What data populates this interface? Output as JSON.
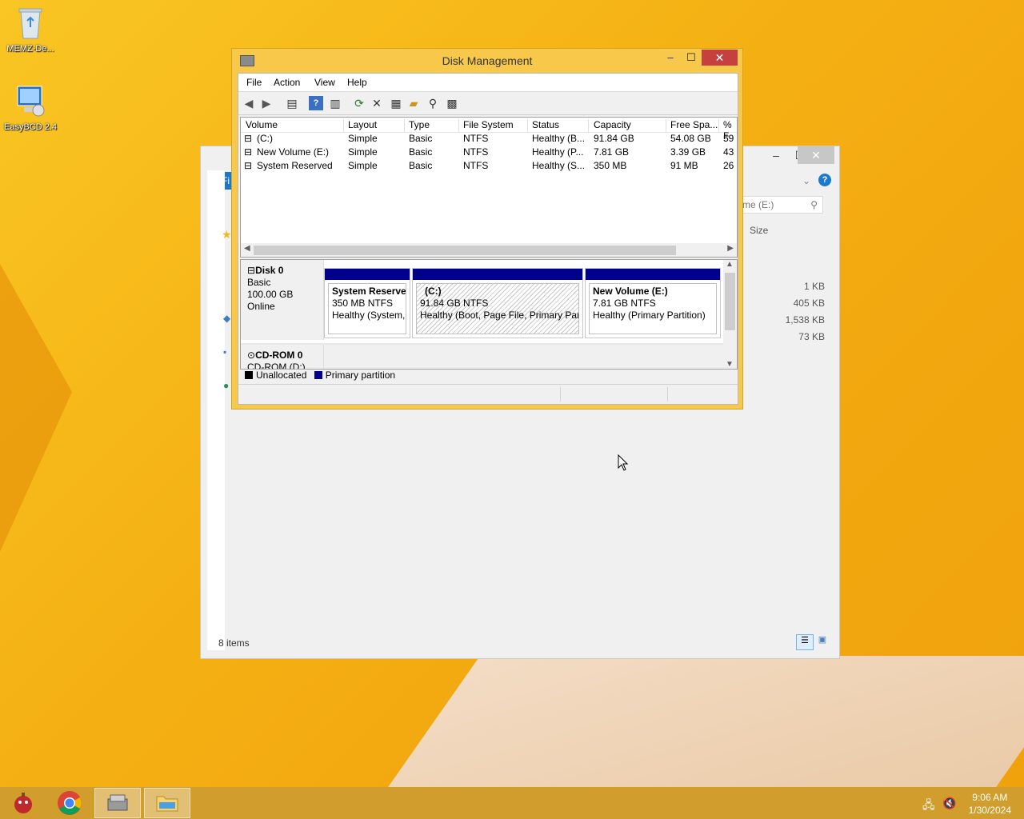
{
  "desktop": {
    "icons": [
      {
        "label": "MEMZ-De..."
      },
      {
        "label": "EasyBCD 2.4"
      }
    ]
  },
  "explorer": {
    "ribbon_tab": "Fi",
    "search_placeholder": "me (E:)",
    "size_header": "Size",
    "sizes": [
      "1 KB",
      "405 KB",
      "1,538 KB",
      "73 KB"
    ],
    "status": "8 items"
  },
  "disk_management": {
    "title": "Disk Management",
    "menu": [
      "File",
      "Action",
      "View",
      "Help"
    ],
    "columns": [
      "Volume",
      "Layout",
      "Type",
      "File System",
      "Status",
      "Capacity",
      "Free Spa...",
      "% F"
    ],
    "volumes": [
      {
        "volume": "(C:)",
        "layout": "Simple",
        "type": "Basic",
        "fs": "NTFS",
        "status": "Healthy (B...",
        "capacity": "91.84 GB",
        "free": "54.08 GB",
        "pct": "59"
      },
      {
        "volume": "New Volume (E:)",
        "layout": "Simple",
        "type": "Basic",
        "fs": "NTFS",
        "status": "Healthy (P...",
        "capacity": "7.81 GB",
        "free": "3.39 GB",
        "pct": "43"
      },
      {
        "volume": "System Reserved",
        "layout": "Simple",
        "type": "Basic",
        "fs": "NTFS",
        "status": "Healthy (S...",
        "capacity": "350 MB",
        "free": "91 MB",
        "pct": "26"
      }
    ],
    "disk0": {
      "name": "Disk 0",
      "kind": "Basic",
      "size": "100.00 GB",
      "state": "Online",
      "partitions": [
        {
          "name": "System Reserved",
          "size": "350 MB NTFS",
          "status": "Healthy (System, A"
        },
        {
          "name": "(C:)",
          "size": "91.84 GB NTFS",
          "status": "Healthy (Boot, Page File, Primary Partition)"
        },
        {
          "name": "New Volume  (E:)",
          "size": "7.81 GB NTFS",
          "status": "Healthy (Primary Partition)"
        }
      ]
    },
    "cdrom": {
      "name": "CD-ROM 0",
      "label": "CD-ROM (D:)"
    },
    "legend": {
      "unallocated": "Unallocated",
      "primary": "Primary partition"
    }
  },
  "clock": {
    "time": "9:06 AM",
    "date": "1/30/2024"
  },
  "colors": {
    "primary_partition": "#00008b",
    "unallocated": "#000000",
    "close_button": "#c74040"
  }
}
